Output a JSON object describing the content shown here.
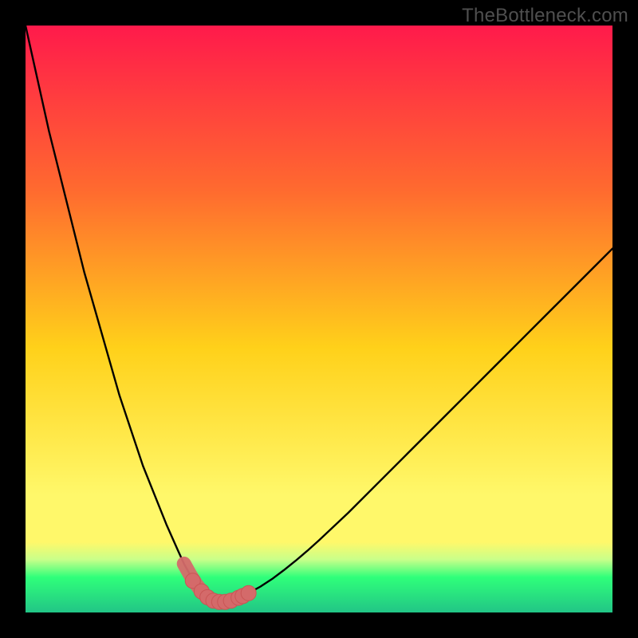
{
  "watermark": "TheBottleneck.com",
  "colors": {
    "frame_bg": "#000000",
    "grad_top": "#ff1a4b",
    "grad_mid_upper": "#ff6a2f",
    "grad_mid": "#ffd11a",
    "grad_low": "#fff86a",
    "grad_band_light": "#c8ff8a",
    "grad_band_green": "#2fff7a",
    "grad_bottom_teal": "#22c586",
    "curve": "#000000",
    "dot_fill": "#d46a6a",
    "dot_stroke": "#c95555"
  },
  "chart_data": {
    "type": "line",
    "title": "",
    "xlabel": "",
    "ylabel": "",
    "xlim": [
      0,
      100
    ],
    "ylim": [
      0,
      100
    ],
    "x": [
      0,
      2,
      4,
      6,
      8,
      10,
      12,
      14,
      16,
      18,
      20,
      22,
      24,
      26,
      27,
      28,
      29,
      30,
      30.5,
      31,
      31.5,
      32,
      33,
      34,
      35,
      36,
      38,
      40,
      42,
      44,
      46,
      48,
      50,
      55,
      60,
      65,
      70,
      75,
      80,
      85,
      90,
      95,
      100
    ],
    "values": [
      100,
      91,
      82,
      74,
      66,
      58,
      51,
      44,
      37,
      31,
      25,
      20,
      15,
      10.5,
      8.3,
      6.5,
      4.9,
      3.6,
      3.05,
      2.6,
      2.25,
      2,
      1.8,
      1.8,
      2.0,
      2.4,
      3.3,
      4.4,
      5.7,
      7.2,
      8.8,
      10.5,
      12.3,
      17.0,
      22.0,
      27.0,
      32.0,
      37.0,
      42.0,
      47.0,
      52.0,
      57.0,
      62.0
    ],
    "markers_x": [
      28.5,
      30.0,
      31.0,
      32.0,
      33.0,
      34.0,
      35.0,
      36.3,
      37.0,
      38.0
    ],
    "markers_y": [
      5.4,
      3.6,
      2.6,
      2.0,
      1.8,
      1.8,
      2.0,
      2.5,
      2.8,
      3.3
    ],
    "line_style": "solid",
    "legend": false,
    "grid": false
  }
}
